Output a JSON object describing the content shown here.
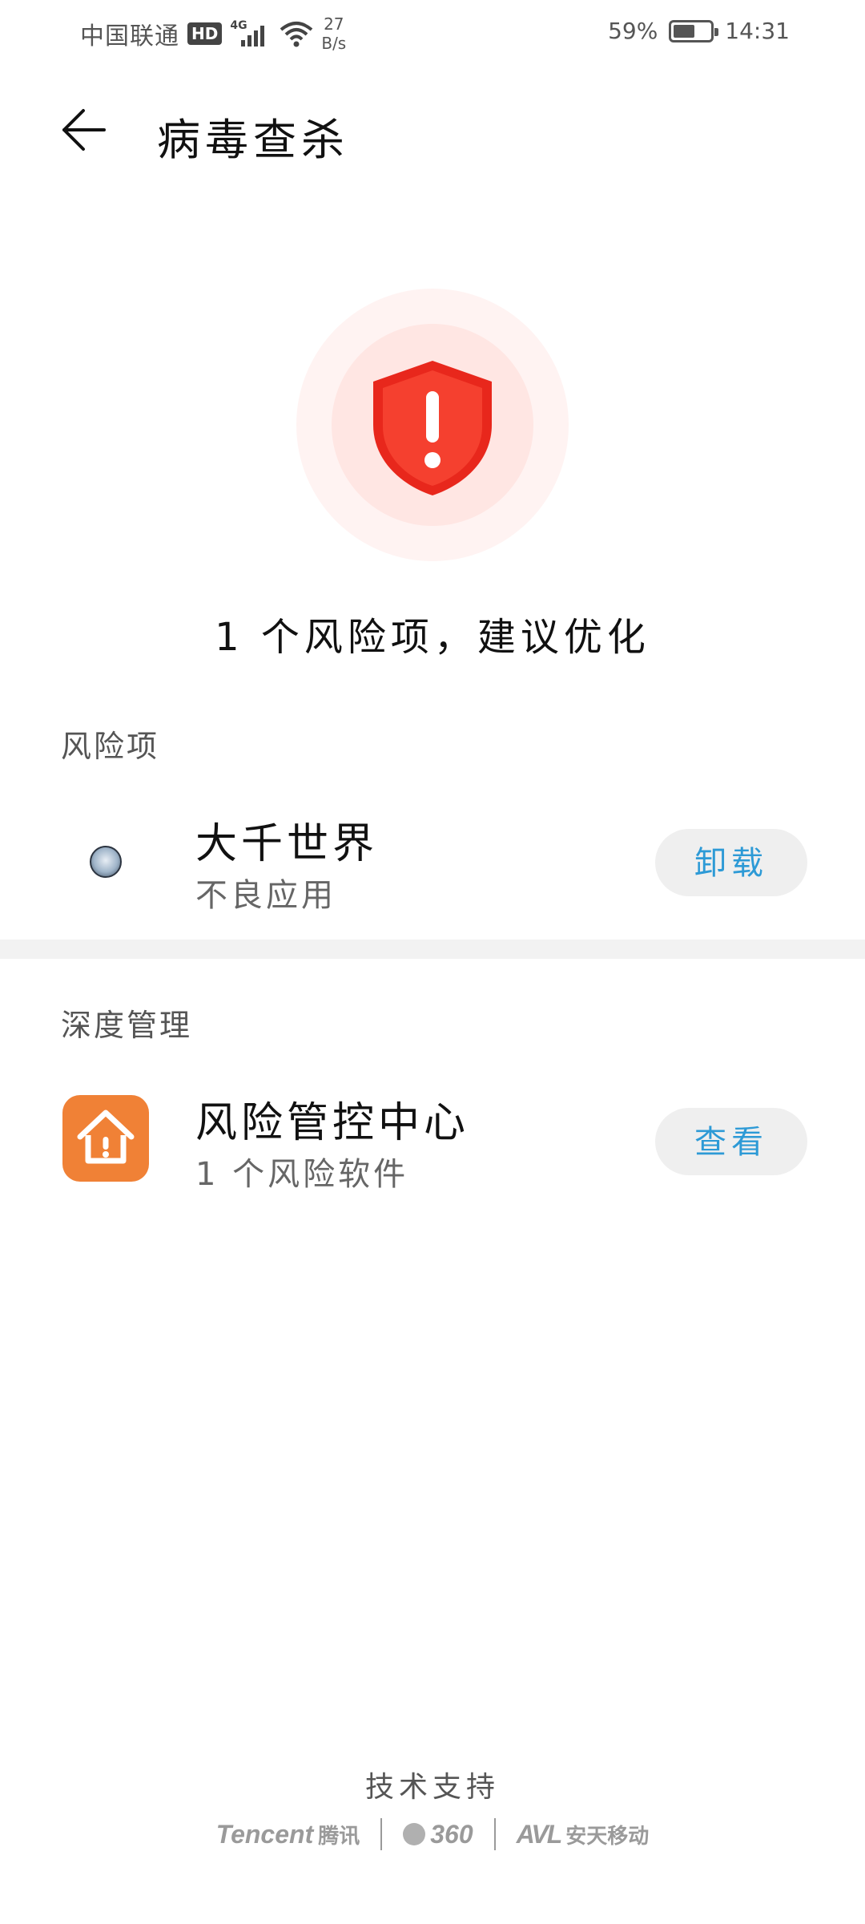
{
  "status_bar": {
    "carrier": "中国联通",
    "hd": "HD",
    "network": "4G",
    "speed_value": "27",
    "speed_unit": "B/s",
    "battery_percent": "59%",
    "battery_level": 0.59,
    "time": "14:31"
  },
  "header": {
    "title": "病毒查杀",
    "back_icon": "arrow-left-icon"
  },
  "hero": {
    "icon": "shield-alert-icon",
    "summary": "1 个风险项，建议优化"
  },
  "risk_section": {
    "label": "风险项",
    "items": [
      {
        "icon": "app-avatar-icon",
        "title": "大千世界",
        "subtitle": "不良应用",
        "action": "卸载"
      }
    ]
  },
  "deep_section": {
    "label": "深度管理",
    "items": [
      {
        "icon": "house-alert-icon",
        "title": "风险管控中心",
        "subtitle": "1 个风险软件",
        "action": "查看"
      }
    ]
  },
  "footer": {
    "label": "技术支持",
    "partners": [
      "Tencent",
      "腾讯",
      "360",
      "AVL",
      "安天移动"
    ]
  },
  "colors": {
    "accent_blue": "#2d9ad6",
    "alert_red": "#ee3124",
    "app_orange": "#f08136"
  }
}
